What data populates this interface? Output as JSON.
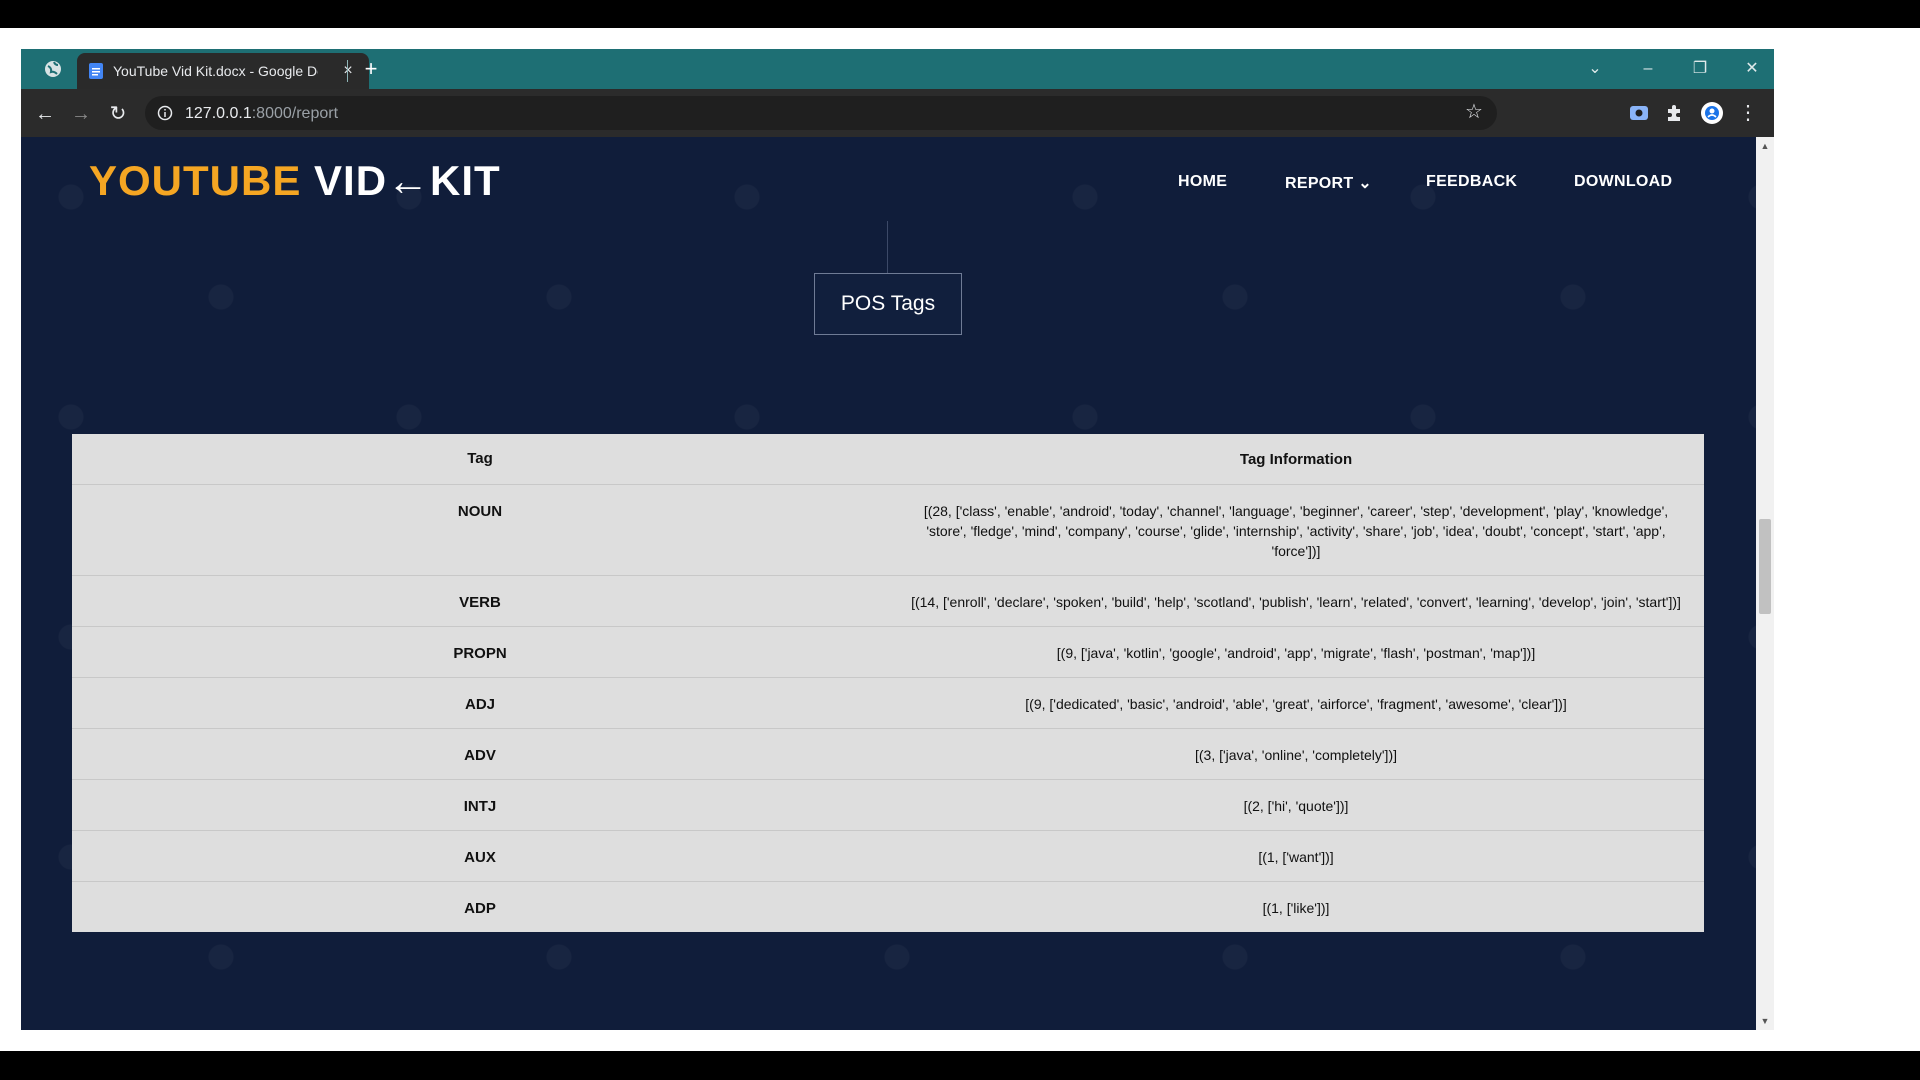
{
  "browser": {
    "tab_title": "YouTube Vid Kit.docx - Google Do",
    "tab_close": "×",
    "new_tab": "+",
    "controls": {
      "minimize": "–",
      "restore": "❐",
      "close": "✕",
      "dropdown": "⌄"
    },
    "url_host": "127.0.0.1",
    "url_path": ":8000/report",
    "star": "☆"
  },
  "site": {
    "logo_part1": "YOUTUBE ",
    "logo_part2": "VID←KIT",
    "nav": {
      "home": "HOME",
      "report": "REPORT ⌄",
      "feedback": "FEEDBACK",
      "download": "DOWNLOAD"
    },
    "section_title": "POS Tags"
  },
  "table": {
    "headers": {
      "tag": "Tag",
      "info": "Tag Information"
    },
    "rows": [
      {
        "tag": "NOUN",
        "info": "[(28, ['class', 'enable', 'android', 'today', 'channel', 'language', 'beginner', 'career', 'step', 'development', 'play', 'knowledge', 'store', 'fledge', 'mind', 'company', 'course', 'glide', 'internship', 'activity', 'share', 'job', 'idea', 'doubt', 'concept', 'start', 'app', 'force'])]"
      },
      {
        "tag": "VERB",
        "info": "[(14, ['enroll', 'declare', 'spoken', 'build', 'help', 'scotland', 'publish', 'learn', 'related', 'convert', 'learning', 'develop', 'join', 'start'])]"
      },
      {
        "tag": "PROPN",
        "info": "[(9, ['java', 'kotlin', 'google', 'android', 'app', 'migrate', 'flash', 'postman', 'map'])]"
      },
      {
        "tag": "ADJ",
        "info": "[(9, ['dedicated', 'basic', 'android', 'able', 'great', 'airforce', 'fragment', 'awesome', 'clear'])]"
      },
      {
        "tag": "ADV",
        "info": "[(3, ['java', 'online', 'completely'])]"
      },
      {
        "tag": "INTJ",
        "info": "[(2, ['hi', 'quote'])]"
      },
      {
        "tag": "AUX",
        "info": "[(1, ['want'])]"
      },
      {
        "tag": "ADP",
        "info": "[(1, ['like'])]"
      }
    ]
  }
}
